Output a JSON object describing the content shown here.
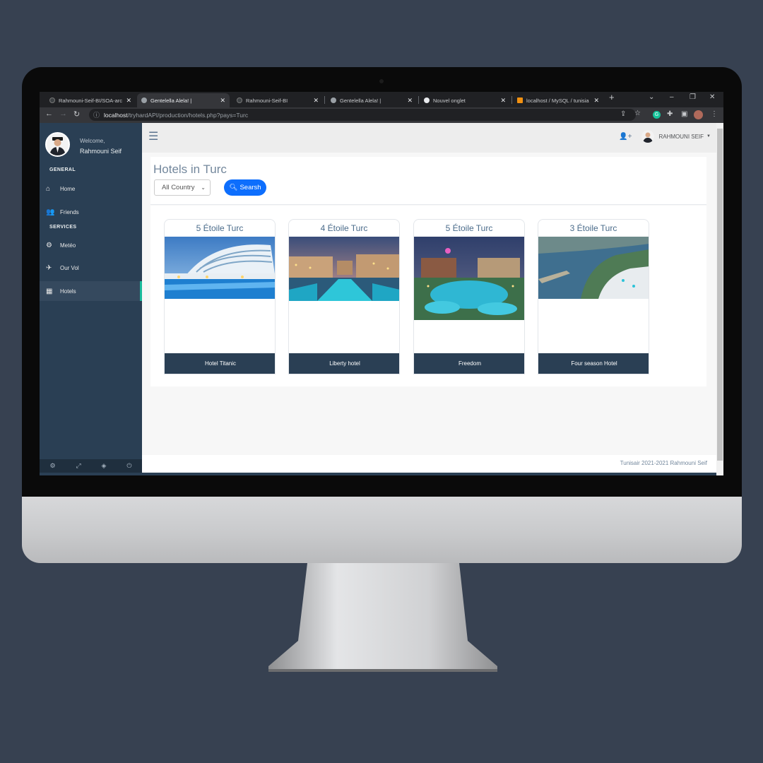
{
  "browser": {
    "tabs": [
      {
        "label": "Rahmouni-Seif-BI/SOA-arc",
        "favicon_color": "#3c4043",
        "active": false
      },
      {
        "label": "Gentelella Alela! |",
        "favicon_color": "#9aa0a6",
        "active": true
      },
      {
        "label": "Rahmouni-Seif-BI",
        "favicon_color": "#3c4043",
        "active": false
      },
      {
        "label": "Gentelella Alela! |",
        "favicon_color": "#9aa0a6",
        "active": false
      },
      {
        "label": "Nouvel onglet",
        "favicon_color": "#e8eaed",
        "active": false
      },
      {
        "label": "localhost / MySQL / tunisia",
        "favicon_color": "#f29111",
        "active": false
      }
    ],
    "url_host": "localhost",
    "url_path": "/tryhardAPI/production/hotels.php?pays=Turc"
  },
  "sidebar": {
    "welcome": "Welcome,",
    "user_name": "Rahmouni Seif",
    "section_general": "GENERAL",
    "section_services": "SERVICES",
    "items": [
      {
        "label": "Home",
        "icon": "home-icon"
      },
      {
        "label": "Friends",
        "icon": "users-icon"
      },
      {
        "label": "Metéo",
        "icon": "gear-icon"
      },
      {
        "label": "Our Vol",
        "icon": "plane-icon"
      },
      {
        "label": "Hotels",
        "icon": "building-icon"
      }
    ]
  },
  "topnav": {
    "user_label": "RAHMOUNI SEIF"
  },
  "page": {
    "title": "Hotels in Turc",
    "country_select": "All Country",
    "search_label": "Searsh"
  },
  "hotels": [
    {
      "stars": "5 Étoile Turc",
      "name": "Hotel Titanic"
    },
    {
      "stars": "4 Étoile Turc",
      "name": "Liberty hotel"
    },
    {
      "stars": "5 Étoile Turc",
      "name": "Freedom"
    },
    {
      "stars": "3 Étoile Turc",
      "name": "Four season Hotel"
    }
  ],
  "footer": {
    "text": "Tunisair 2021-2021 Rahmouni Seif"
  },
  "colors": {
    "sidebar": "#2a3f54",
    "accent": "#1abb9c",
    "search_button": "#0d6efd",
    "backdrop": "#374151"
  }
}
